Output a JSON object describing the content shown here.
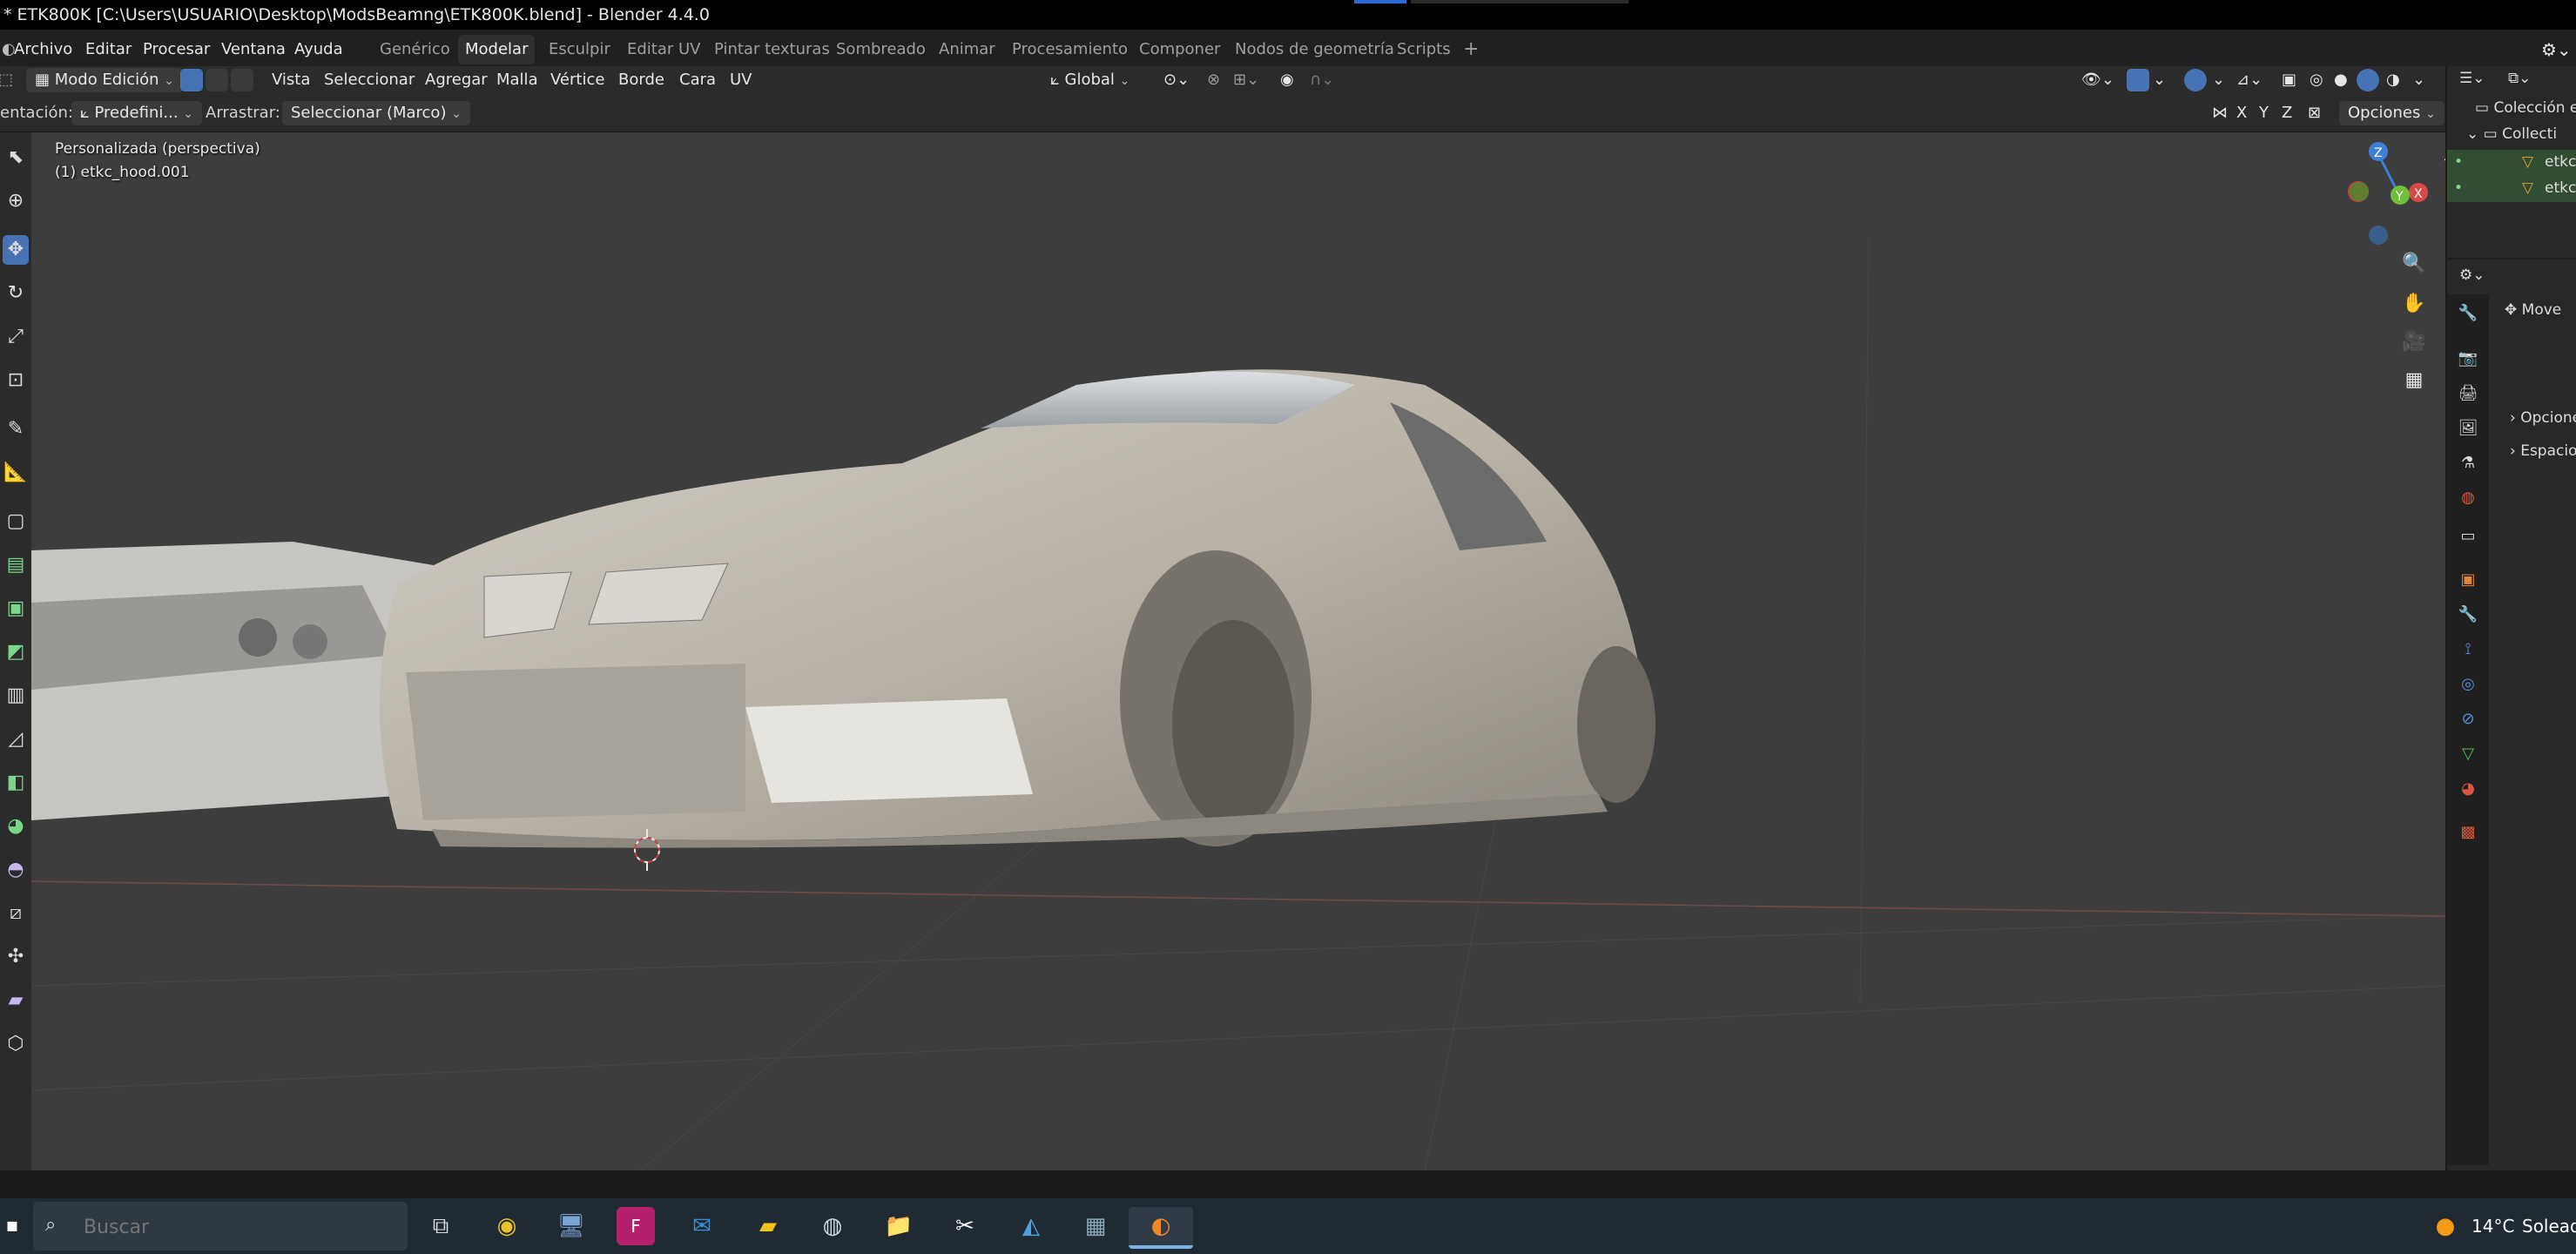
{
  "window": {
    "title": "* ETK800K [C:\\Users\\USUARIO\\Desktop\\ModsBeamng\\ETK800K.blend] - Blender 4.4.0"
  },
  "menu": {
    "items": [
      "Archivo",
      "Editar",
      "Procesar",
      "Ventana",
      "Ayuda"
    ]
  },
  "workspaces": {
    "tabs": [
      "Genérico",
      "Modelar",
      "Esculpir",
      "Editar UV",
      "Pintar texturas",
      "Sombreado",
      "Animar",
      "Procesamiento",
      "Componer",
      "Nodos de geometría",
      "Scripts"
    ],
    "active": "Modelar",
    "add_label": "+"
  },
  "header": {
    "mode": "Modo Edición",
    "menus": [
      "Vista",
      "Seleccionar",
      "Agregar",
      "Malla",
      "Vértice",
      "Borde",
      "Cara",
      "UV"
    ],
    "transform_orientation": "Global"
  },
  "tool_settings": {
    "orientation_label": "entación:",
    "orientation_value": "Predefini...",
    "drag_label": "Arrastrar:",
    "drag_value": "Seleccionar (Marco)",
    "axes": [
      "X",
      "Y",
      "Z"
    ],
    "options_label": "Opciones"
  },
  "viewport": {
    "view_name": "Personalizada (perspectiva)",
    "object_name": "(1) etkc_hood.001",
    "gizmo_axes": [
      "Z",
      "X",
      "Y"
    ]
  },
  "outliner": {
    "title": "Colección e",
    "collection": "Collecti",
    "objects": [
      "etkc",
      "etkc"
    ]
  },
  "properties": {
    "active_tool": "Move",
    "sections": [
      "Opcione",
      "Espacio"
    ]
  },
  "taskbar": {
    "search_placeholder": "Buscar",
    "weather_temp": "14°C",
    "weather_text": "Soleado"
  },
  "colors": {
    "accent": "#4772b3",
    "viewport_bg": "#3d3d3d",
    "panel_bg": "#2b2b2b",
    "selected_row": "#334d33"
  }
}
